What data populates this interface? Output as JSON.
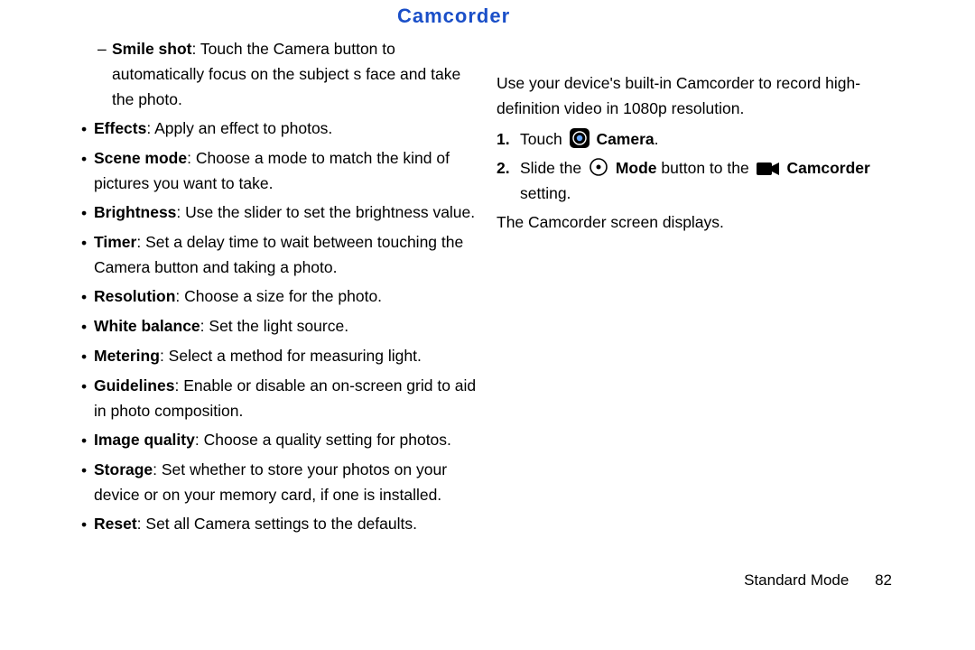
{
  "left": {
    "smile_bold": "Smile shot",
    "smile_text": ": Touch the Camera button to automatically focus on the subject s face and take the photo.",
    "items": [
      {
        "bold": "Effects",
        "text": ": Apply an effect to photos."
      },
      {
        "bold": "Scene mode",
        "text": ": Choose a mode to match the kind of pictures you want to take."
      },
      {
        "bold": "Brightness",
        "text": ": Use the slider to set the brightness value."
      },
      {
        "bold": "Timer",
        "text": ": Set a delay time to wait between touching the Camera button and taking a photo."
      },
      {
        "bold": "Resolution",
        "text": ": Choose a size for the photo."
      },
      {
        "bold": "White balance",
        "text": ": Set the light source."
      },
      {
        "bold": "Metering",
        "text": ": Select a method for measuring light."
      },
      {
        "bold": "Guidelines",
        "text": ": Enable or disable an on-screen grid to aid in photo composition."
      },
      {
        "bold": "Image quality",
        "text": ": Choose a quality setting for photos."
      },
      {
        "bold": "Storage",
        "text": ": Set whether to store your photos on your device or on your memory card, if one is installed."
      },
      {
        "bold": "Reset",
        "text": ": Set all Camera settings to the defaults."
      }
    ]
  },
  "right": {
    "heading": "Camcorder",
    "intro": "Use your device's built-in Camcorder to record high-definition video in 1080p resolution.",
    "step1": {
      "num": "1.",
      "pre": "Touch  ",
      "app": "Camera",
      "post": "."
    },
    "step2": {
      "num": "2.",
      "pre": "Slide the  ",
      "mode": "Mode",
      "mid": " button to the  ",
      "cam": "Camcorder",
      "end": " setting."
    },
    "note": "The Camcorder screen displays."
  },
  "footer": {
    "section": "Standard Mode",
    "page": "82"
  }
}
